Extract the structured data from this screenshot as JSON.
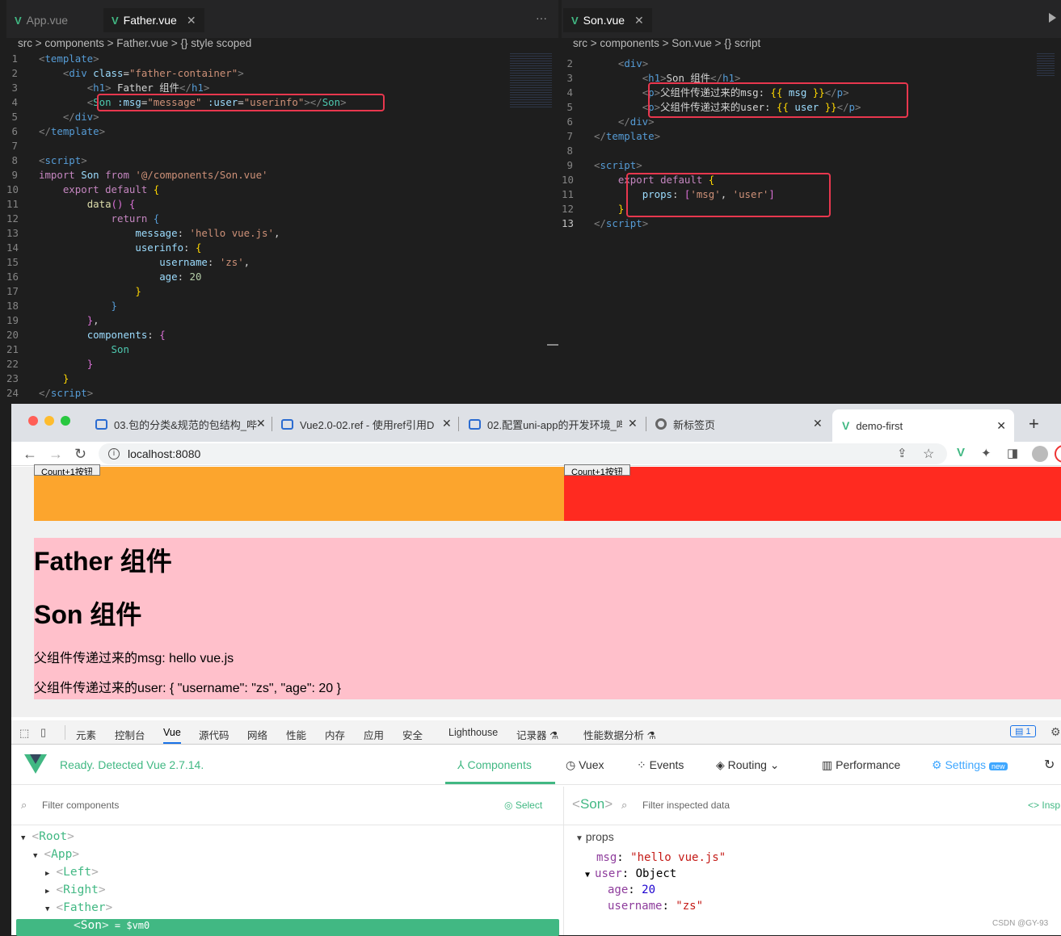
{
  "editor_left": {
    "tabs": [
      {
        "label": "App.vue",
        "active": false
      },
      {
        "label": "Father.vue",
        "active": true
      }
    ],
    "more_label": "···",
    "breadcrumb": "src > components > Father.vue > {} style scoped",
    "lines": [
      {
        "n": "1",
        "html": "<span class='t-br'>&lt;</span><span class='t-tag'>template</span><span class='t-br'>&gt;</span>"
      },
      {
        "n": "2",
        "html": "    <span class='t-br'>&lt;</span><span class='t-tag'>div</span> <span class='t-attr'>class</span>=<span class='t-str'>\"father-container\"</span><span class='t-br'>&gt;</span>"
      },
      {
        "n": "3",
        "html": "        <span class='t-br'>&lt;</span><span class='t-tag'>h1</span><span class='t-br'>&gt;</span><span class='t-txt'> Father 组件</span><span class='t-br'>&lt;/</span><span class='t-tag'>h1</span><span class='t-br'>&gt;</span>"
      },
      {
        "n": "4",
        "html": "        <span class='t-br'>&lt;</span><span class='t-cmp'>Son</span> <span class='t-attr'>:msg</span>=<span class='t-str'>\"message\"</span> <span class='t-attr'>:user</span>=<span class='t-str'>\"userinfo\"</span><span class='t-br'>&gt;&lt;/</span><span class='t-cmp'>Son</span><span class='t-br'>&gt;</span>"
      },
      {
        "n": "5",
        "html": "    <span class='t-br'>&lt;/</span><span class='t-tag'>div</span><span class='t-br'>&gt;</span>"
      },
      {
        "n": "6",
        "html": "<span class='t-br'>&lt;/</span><span class='t-tag'>template</span><span class='t-br'>&gt;</span>"
      },
      {
        "n": "7",
        "html": ""
      },
      {
        "n": "8",
        "html": "<span class='t-br'>&lt;</span><span class='t-tag'>script</span><span class='t-br'>&gt;</span>"
      },
      {
        "n": "9",
        "html": "<span class='t-kw'>import</span> <span class='t-var'>Son</span> <span class='t-kw'>from</span> <span class='t-str'>'@/components/Son.vue'</span>"
      },
      {
        "n": "10",
        "html": "    <span class='t-kw'>export</span> <span class='t-kw'>default</span> <span class='t-y'>{</span>"
      },
      {
        "n": "11",
        "html": "        <span class='t-fn'>data</span><span class='t-p'>()</span> <span class='t-p'>{</span>"
      },
      {
        "n": "12",
        "html": "            <span class='t-kw'>return</span> <span class='t-kw2'>{</span>"
      },
      {
        "n": "13",
        "html": "                <span class='t-var'>message</span>: <span class='t-str'>'hello vue.js'</span>,"
      },
      {
        "n": "14",
        "html": "                <span class='t-var'>userinfo</span>: <span class='t-y'>{</span>"
      },
      {
        "n": "15",
        "html": "                    <span class='t-var'>username</span>: <span class='t-str'>'zs'</span>,"
      },
      {
        "n": "16",
        "html": "                    <span class='t-var'>age</span>: <span class='t-num'>20</span>"
      },
      {
        "n": "17",
        "html": "                <span class='t-y'>}</span>"
      },
      {
        "n": "18",
        "html": "            <span class='t-kw2'>}</span>"
      },
      {
        "n": "19",
        "html": "        <span class='t-p'>}</span>,"
      },
      {
        "n": "20",
        "html": "        <span class='t-var'>components</span>: <span class='t-p'>{</span>"
      },
      {
        "n": "21",
        "html": "            <span class='t-cmp'>Son</span>"
      },
      {
        "n": "22",
        "html": "        <span class='t-p'>}</span>"
      },
      {
        "n": "23",
        "html": "    <span class='t-y'>}</span>"
      },
      {
        "n": "24",
        "html": "<span class='t-br'>&lt;/</span><span class='t-tag'>script</span><span class='t-br'>&gt;</span>"
      }
    ]
  },
  "editor_right": {
    "tabs": [
      {
        "label": "Son.vue",
        "active": true
      }
    ],
    "breadcrumb": "src > components > Son.vue > {} script",
    "lines": [
      {
        "n": "2",
        "html": "    <span class='t-br'>&lt;</span><span class='t-tag'>div</span><span class='t-br'>&gt;</span>"
      },
      {
        "n": "3",
        "html": "        <span class='t-br'>&lt;</span><span class='t-tag'>h1</span><span class='t-br'>&gt;</span><span class='t-txt'>Son 组件</span><span class='t-br'>&lt;/</span><span class='t-tag'>h1</span><span class='t-br'>&gt;</span>"
      },
      {
        "n": "4",
        "html": "        <span class='t-br'>&lt;</span><span class='t-tag'>p</span><span class='t-br'>&gt;</span><span class='t-txt'>父组件传递过来的msg: </span><span class='t-y'>{{</span> <span class='t-var'>msg</span> <span class='t-y'>}}</span><span class='t-br'>&lt;/</span><span class='t-tag'>p</span><span class='t-br'>&gt;</span>"
      },
      {
        "n": "5",
        "html": "        <span class='t-br'>&lt;</span><span class='t-tag'>p</span><span class='t-br'>&gt;</span><span class='t-txt'>父组件传递过来的user: </span><span class='t-y'>{{</span> <span class='t-var'>user</span> <span class='t-y'>}}</span><span class='t-br'>&lt;/</span><span class='t-tag'>p</span><span class='t-br'>&gt;</span>"
      },
      {
        "n": "6",
        "html": "    <span class='t-br'>&lt;/</span><span class='t-tag'>div</span><span class='t-br'>&gt;</span>"
      },
      {
        "n": "7",
        "html": "<span class='t-br'>&lt;/</span><span class='t-tag'>template</span><span class='t-br'>&gt;</span>"
      },
      {
        "n": "8",
        "html": ""
      },
      {
        "n": "9",
        "html": "<span class='t-br'>&lt;</span><span class='t-tag'>script</span><span class='t-br'>&gt;</span>"
      },
      {
        "n": "10",
        "html": "    <span class='t-kw'>export</span> <span class='t-kw'>default</span> <span class='t-y'>{</span>"
      },
      {
        "n": "11",
        "html": "        <span class='t-var'>props</span>: <span class='t-p'>[</span><span class='t-str'>'msg'</span>, <span class='t-str'>'user'</span><span class='t-p'>]</span>"
      },
      {
        "n": "12",
        "html": "    <span class='t-y'>}</span>"
      },
      {
        "n": "13",
        "html": "<span class='t-br'>&lt;/</span><span class='t-tag'>script</span><span class='t-br'>&gt;</span>"
      }
    ]
  },
  "browser": {
    "tabs": [
      {
        "label": "03.包的分类&规范的包结构_哔",
        "active": false
      },
      {
        "label": "Vue2.0-02.ref - 使用ref引用D",
        "active": false
      },
      {
        "label": "02.配置uni-app的开发环境_哔",
        "active": false
      },
      {
        "label": "新标签页",
        "active": false
      },
      {
        "label": "demo-first",
        "active": true
      }
    ],
    "new_tab": "+",
    "address": "localhost:8080",
    "colors": {
      "orange": "#fca52d",
      "red": "#ff2a20",
      "pink": "#ffc0cb"
    },
    "count_button": "Count+1按钮",
    "father_title": "Father 组件",
    "son_title": "Son 组件",
    "msg_line": "父组件传递过来的msg: hello vue.js",
    "user_line": "父组件传递过来的user: { \"username\": \"zs\", \"age\": 20 }"
  },
  "devtools": {
    "tabs": [
      "元素",
      "控制台",
      "Vue",
      "源代码",
      "网络",
      "性能",
      "内存",
      "应用",
      "安全",
      "Lighthouse",
      "记录器 ⚗",
      "性能数据分析 ⚗"
    ],
    "issues_badge": "1",
    "status": "Ready. Detected Vue 2.7.14.",
    "nav": {
      "components": "Components",
      "vuex": "Vuex",
      "events": "Events",
      "routing": "Routing",
      "performance": "Performance",
      "settings": "Settings",
      "new_badge": "new"
    },
    "filter_placeholder": "Filter components",
    "select_label": "Select",
    "inspected_component": "Son",
    "filter_inspected_placeholder": "Filter inspected data",
    "inspect_label": "Insp",
    "tree": [
      {
        "name": "Root",
        "depth": 0,
        "arrow": "▼"
      },
      {
        "name": "App",
        "depth": 1,
        "arrow": "▼"
      },
      {
        "name": "Left",
        "depth": 2,
        "arrow": "▶"
      },
      {
        "name": "Right",
        "depth": 2,
        "arrow": "▶"
      },
      {
        "name": "Father",
        "depth": 2,
        "arrow": "▼"
      },
      {
        "name": "Son",
        "depth": 3,
        "arrow": "",
        "selected": true,
        "suffix": " = $vm0"
      }
    ],
    "props_label": "props",
    "msg_key": "msg",
    "msg_value": "\"hello vue.js\"",
    "user_key": "user",
    "user_value": "Object",
    "age_key": "age",
    "age_value": "20",
    "username_key": "username",
    "username_value": "\"zs\""
  },
  "watermark": "CSDN @GY-93"
}
